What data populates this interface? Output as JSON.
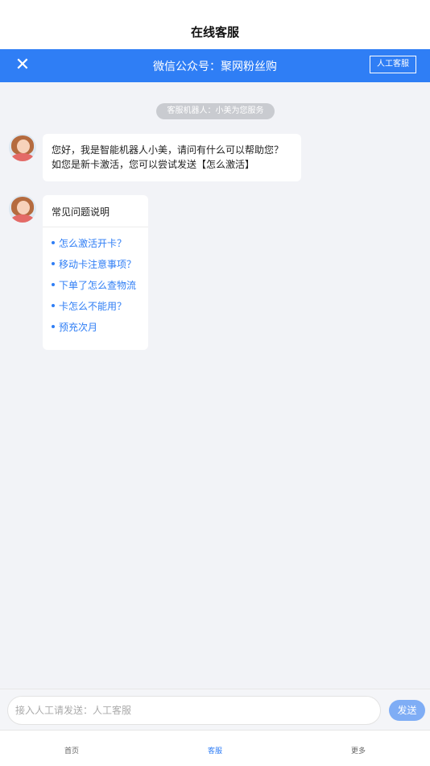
{
  "page": {
    "title": "在线客服"
  },
  "header": {
    "close_icon": "close-icon",
    "title": "微信公众号：聚网粉丝购",
    "human_service_label": "人工客服"
  },
  "chat": {
    "system_notice": "客服机器人：小美为您服务",
    "greeting": {
      "line1": "您好，我是智能机器人小美，请问有什么可以帮助您？",
      "line2": "如您是新卡激活，您可以尝试发送【怎么激活】"
    },
    "faq": {
      "title": "常见问题说明",
      "items": [
        "怎么激活开卡？",
        "移动卡注意事项？",
        "下单了怎么查物流",
        "卡怎么不能用？",
        "预充次月"
      ]
    }
  },
  "input": {
    "placeholder": "接入人工请发送：人工客服",
    "send_label": "发送"
  },
  "tabbar": {
    "items": [
      "首页",
      "客服",
      "更多"
    ],
    "active": "客服"
  },
  "colors": {
    "accent": "#2f7ef5",
    "send_button": "#7fadf5",
    "background": "#f2f3f7"
  }
}
